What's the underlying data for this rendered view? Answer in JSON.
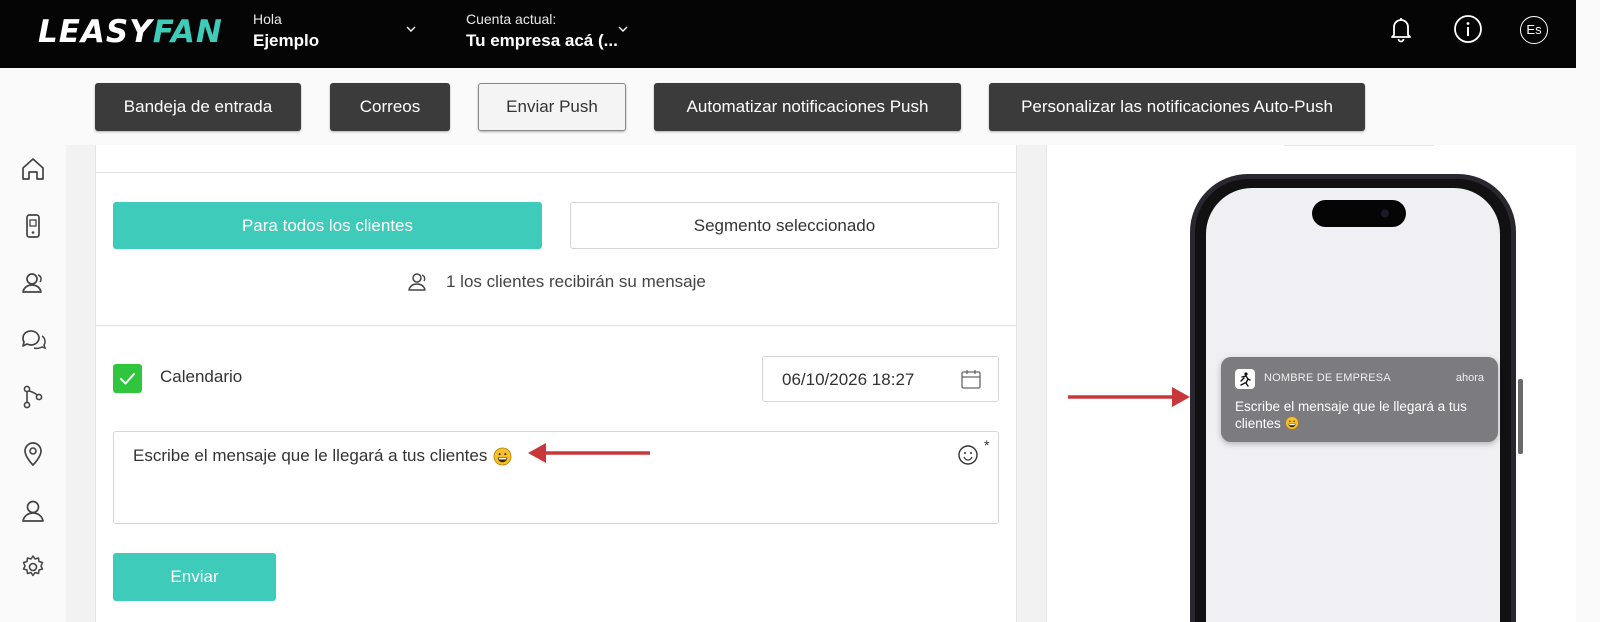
{
  "header": {
    "logo_part1": "LEASY",
    "logo_part2": "FAN",
    "greeting_label": "Hola",
    "user_name": "Ejemplo",
    "account_label": "Cuenta actual:",
    "account_name": "Tu empresa acá (...",
    "language": "Es",
    "icons": [
      "bell-icon",
      "info-icon"
    ]
  },
  "tabs": [
    {
      "label": "Bandeja de entrada",
      "active": false
    },
    {
      "label": "Correos",
      "active": false
    },
    {
      "label": "Enviar Push",
      "active": true
    },
    {
      "label": "Automatizar notificaciones Push",
      "active": false
    },
    {
      "label": "Personalizar las notificaciones Auto-Push",
      "active": false
    }
  ],
  "sidebar": {
    "icons": [
      "home-icon",
      "mobile-icon",
      "customers-icon",
      "chat-icon",
      "flow-icon",
      "location-icon",
      "user-icon",
      "settings-icon"
    ]
  },
  "audience": {
    "all_label": "Para todos los clientes",
    "segment_label": "Segmento seleccionado",
    "recipients_text": "1 los clientes recibirán su mensaje"
  },
  "schedule": {
    "checked": true,
    "label": "Calendario",
    "date_value": "06/10/2026 18:27"
  },
  "message": {
    "text": "Escribe el mensaje que le llegará a tus clientes",
    "required_mark": "*"
  },
  "send_label": "Enviar",
  "preview": {
    "app_name": "NOMBRE DE EMPRESA",
    "time": "ahora",
    "body": "Escribe el mensaje que le llegará a tus clientes"
  },
  "colors": {
    "accent": "#3ecbb9",
    "header_bg": "#050505",
    "tab_bg": "#3b3b3b",
    "checkbox": "#2fc63e",
    "arrow": "#c8383a"
  }
}
